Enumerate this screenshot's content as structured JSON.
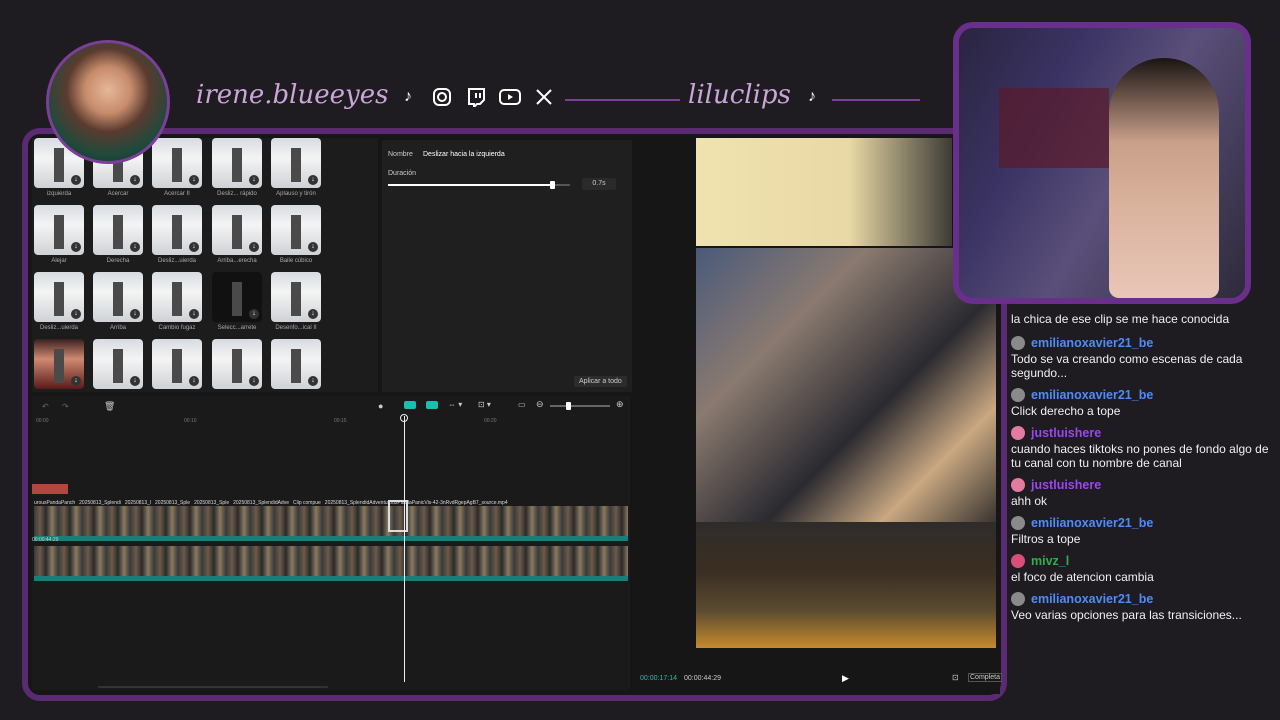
{
  "header": {
    "handle": "irene.blueeyes",
    "handle2": "liluclips",
    "social_icons": [
      "tiktok-icon",
      "instagram-icon",
      "twitch-icon",
      "youtube-icon",
      "x-icon"
    ]
  },
  "effects": {
    "tiles": [
      {
        "label": "izquierda"
      },
      {
        "label": "Acercar"
      },
      {
        "label": "Acercar II"
      },
      {
        "label": "Desliz... rápido"
      },
      {
        "label": "Aplauso y tirón"
      },
      {
        "label": "Alejar"
      },
      {
        "label": "Derecha"
      },
      {
        "label": "Desliz...uierda"
      },
      {
        "label": "Arriba...erecha"
      },
      {
        "label": "Baile cúbico"
      },
      {
        "label": "Desliz...uierda"
      },
      {
        "label": "Arriba"
      },
      {
        "label": "Cambio fugaz"
      },
      {
        "label": "Selecc...arrete"
      },
      {
        "label": "Desenfo...ical II"
      },
      {
        "label": ""
      },
      {
        "label": ""
      },
      {
        "label": ""
      },
      {
        "label": ""
      },
      {
        "label": ""
      }
    ]
  },
  "props": {
    "name_label": "Nombre",
    "name_value": "Deslizar hacia la izquierda",
    "duration_label": "Duración",
    "duration_value": "0.7s",
    "duration_fraction": 0.9,
    "apply_all": "Aplicar a todo"
  },
  "timeline": {
    "ticks": [
      "00:00",
      "00:10",
      "00:15",
      "00:20"
    ],
    "clip_labels": [
      "urousPandaPanch",
      "20250813_Splendi",
      "20250813_l",
      "20250813_Sple",
      "20250813_Sple",
      "20250813_SplendidAdve",
      "Clip compue",
      "20250813_SplendidAdventurousPandaPanicVis-42-3nRvdRgepAgB7_source.mp4"
    ],
    "main_timecode": "00:00:44:29"
  },
  "preview": {
    "current_time": "00:00:17:14",
    "total_time": "00:00:44:29",
    "complete_label": "Completa"
  },
  "chat": {
    "first_msg": "la chica de ese clip se me hace conocida",
    "messages": [
      {
        "user": "emilianoxavier21_be",
        "color": "#4f8cf7",
        "text": "Todo se va creando como escenas de cada segundo..."
      },
      {
        "user": "emilianoxavier21_be",
        "color": "#4f8cf7",
        "text": "Click derecho a tope"
      },
      {
        "user": "justluishere",
        "color": "#9a47f0",
        "text": "cuando haces tiktoks no pones de fondo algo de tu canal con tu nombre de canal"
      },
      {
        "user": "justluishere",
        "color": "#9a47f0",
        "text": "ahh ok"
      },
      {
        "user": "emilianoxavier21_be",
        "color": "#4f8cf7",
        "text": "Filtros a tope"
      },
      {
        "user": "mivz_l",
        "color": "#2fae52",
        "text": "el foco de atencion cambia"
      },
      {
        "user": "emilianoxavier21_be",
        "color": "#4f8cf7",
        "text": "Veo varias opciones para las transiciones..."
      }
    ]
  }
}
